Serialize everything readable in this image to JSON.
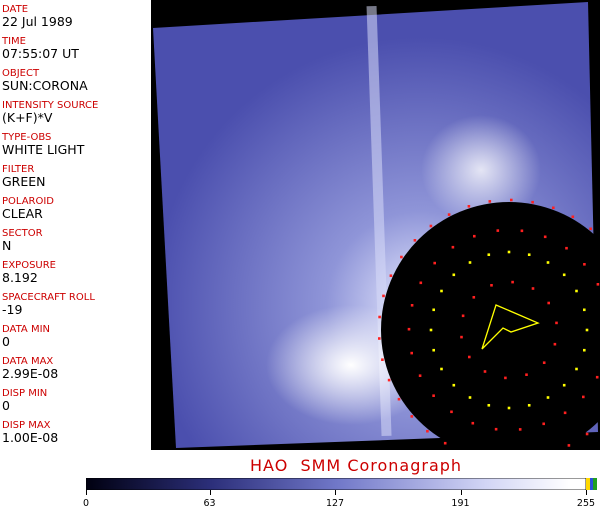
{
  "info_fields": [
    {
      "label": "DATE",
      "value": "22 Jul 1989"
    },
    {
      "label": "TIME",
      "value": "07:55:07 UT"
    },
    {
      "label": "OBJECT",
      "value": "SUN:CORONA"
    },
    {
      "label": "INTENSITY SOURCE",
      "value": "(K+F)*V"
    },
    {
      "label": "TYPE-OBS",
      "value": "WHITE LIGHT"
    },
    {
      "label": "FILTER",
      "value": "GREEN"
    },
    {
      "label": "POLAROID",
      "value": "CLEAR"
    },
    {
      "label": "SECTOR",
      "value": "N"
    },
    {
      "label": "EXPOSURE",
      "value": "8.192"
    },
    {
      "label": "SPACECRAFT ROLL",
      "value": "-19"
    },
    {
      "label": "DATA MIN",
      "value": "0"
    },
    {
      "label": "DATA MAX",
      "value": "2.99E-08"
    },
    {
      "label": "DISP MIN",
      "value": "0"
    },
    {
      "label": "DISP MAX",
      "value": "1.00E-08"
    }
  ],
  "title": "HAO  SMM Coronagraph",
  "colorbar": {
    "ticks": [
      "0",
      "63",
      "127",
      "191",
      "255"
    ],
    "min": 0,
    "max": 255,
    "colors": {
      "dark": "#0a0a2e",
      "mid": "#5d63b8",
      "light": "#ffffff"
    }
  },
  "colors": {
    "label_red": "#cc0000",
    "overlay_yellow": "#ffff00",
    "overlay_red": "#ff2020"
  }
}
